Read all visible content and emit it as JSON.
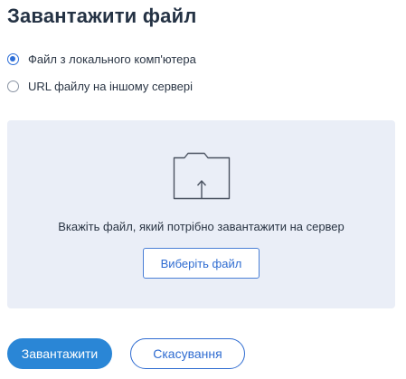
{
  "page": {
    "title": "Завантажити файл"
  },
  "source_options": {
    "selected": "local",
    "items": [
      {
        "id": "local",
        "label": "Файл з локального комп'ютера",
        "checked": true
      },
      {
        "id": "url",
        "label": "URL файлу на іншому сервері",
        "checked": false
      }
    ]
  },
  "dropzone": {
    "icon": "folder-upload-icon",
    "instruction": "Вкажіть файл, який потрібно завантажити на сервер",
    "choose_label": "Виберіть файл"
  },
  "actions": {
    "upload_label": "Завантажити",
    "cancel_label": "Скасування"
  },
  "colors": {
    "accent": "#2a86d6",
    "link_blue": "#2f6cd1",
    "dropzone_bg": "#eaeef7",
    "title": "#243244"
  }
}
